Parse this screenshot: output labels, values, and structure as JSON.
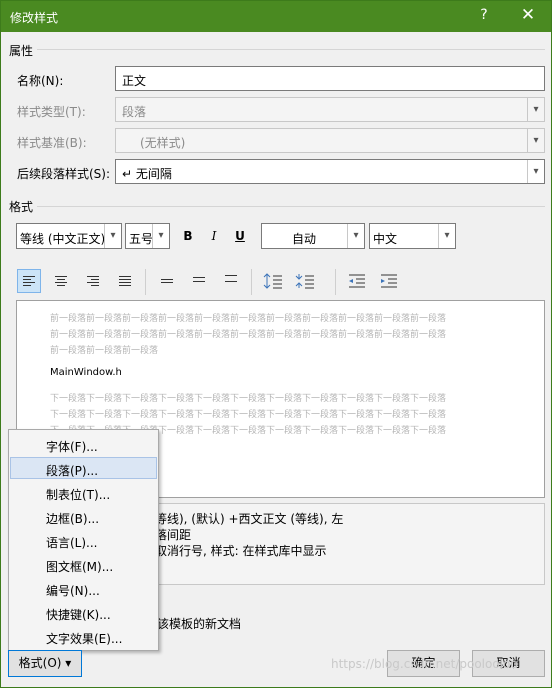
{
  "window": {
    "title": "修改样式",
    "help_label": "?",
    "close_label": "✕"
  },
  "properties": {
    "section_label": "属性",
    "name_label": "名称(N):",
    "name_value": "正文",
    "type_label": "样式类型(T):",
    "type_value": "段落",
    "based_label": "样式基准(B):",
    "based_value": "(无样式)",
    "next_label": "后续段落样式(S):",
    "next_value": "↵ 无间隔"
  },
  "format": {
    "section_label": "格式",
    "font": "等线 (中文正文)",
    "size": "五号",
    "bold": "B",
    "italic": "I",
    "underline": "U",
    "color": "自动",
    "lang": "中文"
  },
  "preview": {
    "prev_lines": [
      "前一段落前一段落前一段落前一段落前一段落前一段落前一段落前一段落前一段落前一段落前一段落",
      "前一段落前一段落前一段落前一段落前一段落前一段落前一段落前一段落前一段落前一段落前一段落",
      "前一段落前一段落前一段落"
    ],
    "sample": "MainWindow.h",
    "next_lines": [
      "下一段落下一段落下一段落下一段落下一段落下一段落下一段落下一段落下一段落下一段落下一段落",
      "下一段落下一段落下一段落下一段落下一段落下一段落下一段落下一段落下一段落下一段落下一段落",
      "下一段落下一段落下一段落下一段落下一段落下一段落下一段落下一段落下一段落下一段落下一段落"
    ]
  },
  "description": {
    "line1": "等线), (默认) +西文正文 (等线), 左",
    "line2": "落间距",
    "line3": "取消行号, 样式: 在样式库中显示"
  },
  "template_text": "该模板的新文档",
  "menu": {
    "items": [
      "字体(F)...",
      "段落(P)...",
      "制表位(T)...",
      "边框(B)...",
      "语言(L)...",
      "图文框(M)...",
      "编号(N)...",
      "快捷键(K)...",
      "文字效果(E)..."
    ],
    "selected_index": 1
  },
  "buttons": {
    "format": "格式(O) ▾",
    "ok": "确定",
    "cancel": "取消"
  },
  "watermark": "https://blog.csdn.net/poolooloo"
}
